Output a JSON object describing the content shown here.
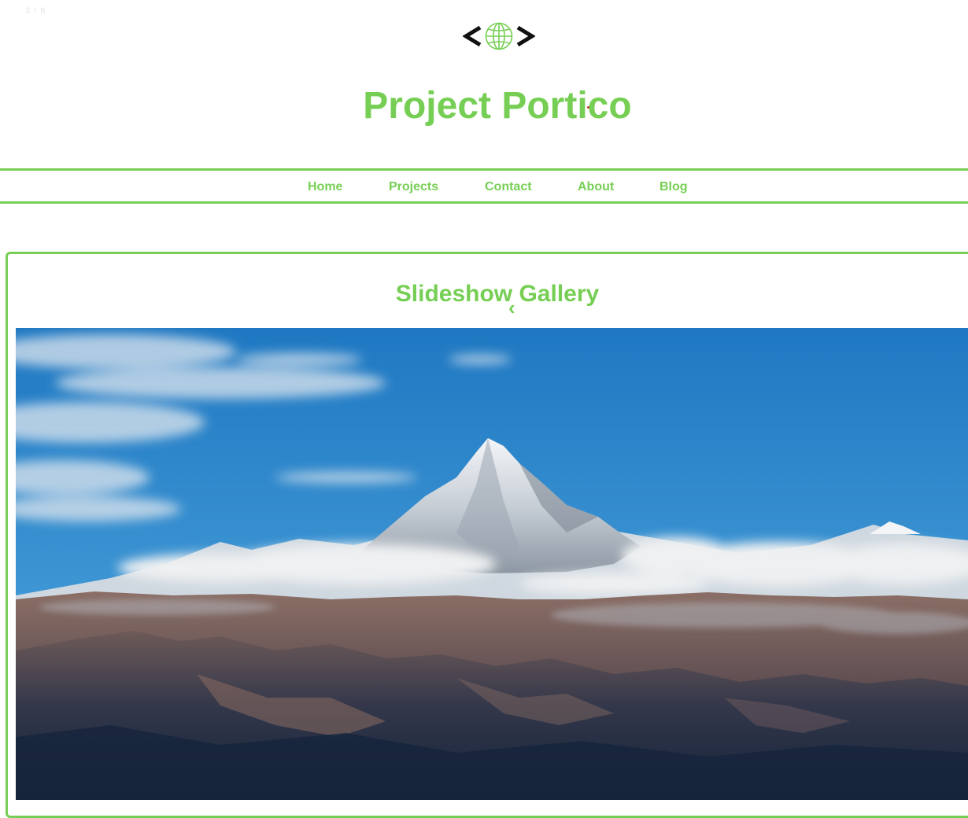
{
  "slideshow": {
    "counter": "3 / 6"
  },
  "header": {
    "logo_icon": "code-globe-icon",
    "title": "Project Portico"
  },
  "nav": {
    "items": [
      {
        "label": "Home"
      },
      {
        "label": "Projects"
      },
      {
        "label": "Contact"
      },
      {
        "label": "About"
      },
      {
        "label": "Blog"
      }
    ]
  },
  "gallery": {
    "title": "Slideshow Gallery",
    "prev_icon": "chevron-left-icon",
    "current_slide": 3,
    "total_slides": 6,
    "image_subject": "snow-capped mountain peak"
  },
  "colors": {
    "accent": "#76cf54",
    "sky": "#2f86c8",
    "text_muted": "#e4e4e4"
  }
}
